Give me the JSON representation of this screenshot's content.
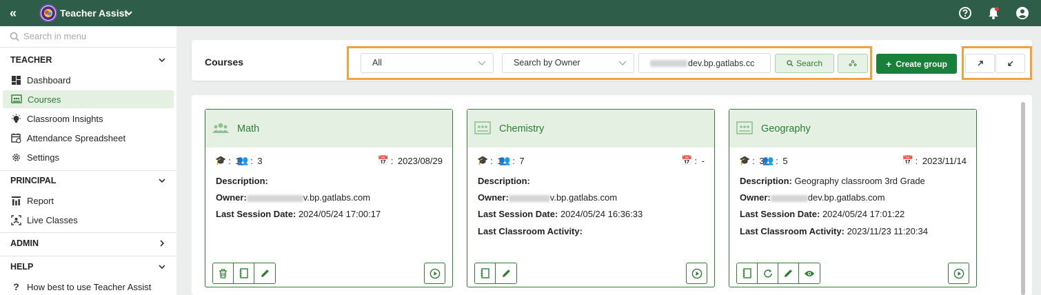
{
  "app": {
    "title": "Teacher Assist"
  },
  "sidebar": {
    "search_placeholder": "Search in menu",
    "sections": [
      {
        "title": "TEACHER",
        "items": [
          {
            "label": "Dashboard",
            "icon": "dashboard-icon"
          },
          {
            "label": "Courses",
            "icon": "courses-icon",
            "active": true
          },
          {
            "label": "Classroom Insights",
            "icon": "lightbulb-icon"
          },
          {
            "label": "Attendance Spreadsheet",
            "icon": "calendar-icon"
          },
          {
            "label": "Settings",
            "icon": "gear-icon"
          }
        ]
      },
      {
        "title": "PRINCIPAL",
        "items": [
          {
            "label": "Report",
            "icon": "report-icon"
          },
          {
            "label": "Live Classes",
            "icon": "live-classes-icon"
          }
        ]
      },
      {
        "title": "ADMIN",
        "items": []
      },
      {
        "title": "HELP",
        "items": [
          {
            "label": "How best to use Teacher Assist",
            "icon": "question-icon"
          }
        ]
      }
    ]
  },
  "toolbar": {
    "title": "Courses",
    "filter_select": "All",
    "owner_select": "Search by Owner",
    "owner_input_value": "dev.bp.gatlabs.cc",
    "search_label": "Search",
    "create_group_label": "Create group"
  },
  "courses": [
    {
      "name": "Math",
      "teachers": "1",
      "students": "3",
      "date": "2023/08/29",
      "description_label": "Description:",
      "description": "",
      "owner_label": "Owner:",
      "owner_visible": "v.bp.gatlabs.com",
      "last_session_label": "Last Session Date:",
      "last_session": "2024/05/24 17:00:17",
      "last_activity_label": "",
      "last_activity": ""
    },
    {
      "name": "Chemistry",
      "teachers": "1",
      "students": "7",
      "date": "-",
      "description_label": "Description:",
      "description": "",
      "owner_label": "Owner:",
      "owner_visible": "v.bp.gatlabs.com",
      "last_session_label": "Last Session Date:",
      "last_session": "2024/05/24 16:36:33",
      "last_activity_label": "Last Classroom Activity:",
      "last_activity": ""
    },
    {
      "name": "Geography",
      "teachers": "3",
      "students": "5",
      "date": "2023/11/14",
      "description_label": "Description:",
      "description": "Geography classroom 3rd Grade",
      "owner_label": "Owner:",
      "owner_visible": "dev.bp.gatlabs.com",
      "last_session_label": "Last Session Date:",
      "last_session": "2024/05/24 17:01:22",
      "last_activity_label": "Last Classroom Activity:",
      "last_activity": "2023/11/23 11:20:34"
    }
  ],
  "colors": {
    "topbar": "#2e5e4a",
    "accent_green": "#2e7d32",
    "primary_button": "#188038",
    "highlight_orange": "#f0a23c",
    "card_header_bg": "#e3f0e2"
  }
}
